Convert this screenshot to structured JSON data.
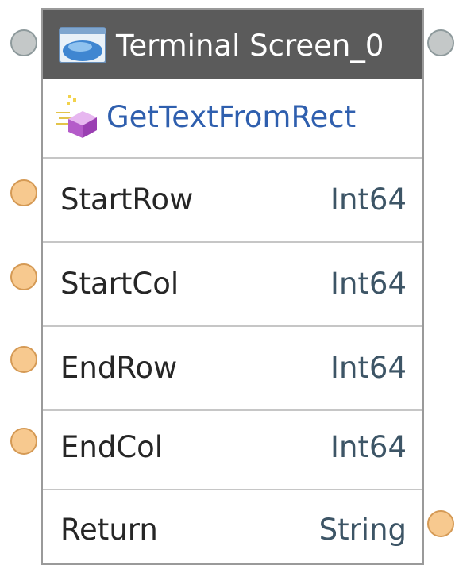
{
  "header": {
    "title": "Terminal Screen_0",
    "icon": "terminal-screen-icon",
    "background_color": "#5b5b5b"
  },
  "method": {
    "name": "GetTextFromRect",
    "icon": "method-icon",
    "color": "#2f5fae"
  },
  "params": [
    {
      "name": "StartRow",
      "type": "Int64",
      "port": "input"
    },
    {
      "name": "StartCol",
      "type": "Int64",
      "port": "input"
    },
    {
      "name": "EndRow",
      "type": "Int64",
      "port": "input"
    },
    {
      "name": "EndCol",
      "type": "Int64",
      "port": "input"
    },
    {
      "name": "Return",
      "type": "String",
      "port": "output"
    }
  ],
  "colors": {
    "data_port": "#f7c98f",
    "exec_port": "#c4c8c8"
  }
}
